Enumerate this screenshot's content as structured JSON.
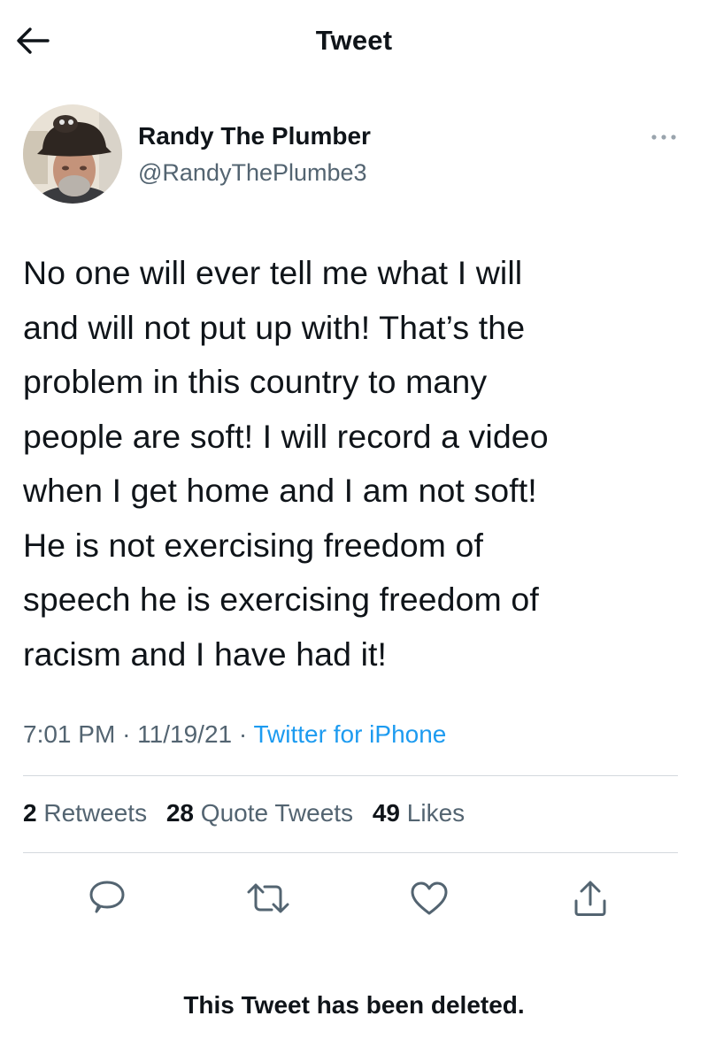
{
  "header": {
    "title": "Tweet",
    "back_icon": "arrow-left-icon"
  },
  "author": {
    "name": "Randy The Plumber",
    "handle": "@RandyThePlumbe3",
    "more_icon": "more-horizontal-icon"
  },
  "tweet": {
    "text_lines": [
      "No one will ever tell me what I will",
      "and will not put up with! That’s the",
      "problem in this country to many",
      "people are soft! I will record a video",
      "when I get home and I am not soft!",
      "He is not exercising freedom of",
      "speech he is exercising freedom of",
      "racism and I have had it!"
    ],
    "time": "7:01 PM",
    "separator": "·",
    "date": "11/19/21",
    "source": "Twitter for iPhone"
  },
  "stats": {
    "retweets_count": "2",
    "retweets_label": "Retweets",
    "quotes_count": "28",
    "quotes_label": "Quote Tweets",
    "likes_count": "49",
    "likes_label": "Likes"
  },
  "actions": [
    {
      "icon": "reply-icon"
    },
    {
      "icon": "retweet-icon"
    },
    {
      "icon": "like-icon"
    },
    {
      "icon": "share-icon"
    }
  ],
  "notice": {
    "deleted_text": "This Tweet has been deleted."
  },
  "colors": {
    "text": "#0f1419",
    "secondary": "#536471",
    "link": "#1d9bf0",
    "divider": "#d4d9dd"
  }
}
